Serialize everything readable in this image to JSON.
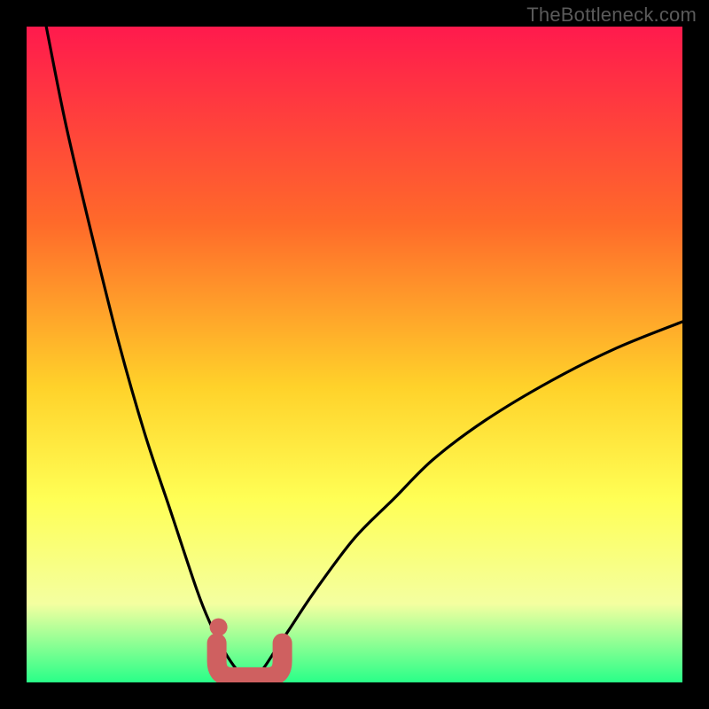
{
  "watermark": "TheBottleneck.com",
  "colors": {
    "bg": "#000000",
    "grad_top": "#ff1a4d",
    "grad_mid1": "#ff6a2a",
    "grad_mid2": "#ffd22a",
    "grad_mid3": "#ffff55",
    "grad_mid4": "#f4ffa0",
    "grad_bottom": "#29ff88",
    "curve": "#000000",
    "marker": "#cf6060"
  },
  "chart_data": {
    "type": "line",
    "title": "",
    "xlabel": "",
    "ylabel": "",
    "xlim": [
      0,
      100
    ],
    "ylim": [
      0,
      100
    ],
    "curve_description": "Two-branch bottleneck curve: y represents bottleneck percentage vs a parameter x (0–100). Minimum (≈0%) occurs near x≈34. Left branch rises steeply toward 100% as x→0; right branch rises more gently toward ~55% as x→100.",
    "series": [
      {
        "name": "bottleneck-curve",
        "x": [
          3,
          6,
          10,
          14,
          18,
          22,
          26,
          28,
          30,
          32,
          34,
          36,
          38,
          40,
          44,
          50,
          56,
          62,
          70,
          80,
          90,
          100
        ],
        "y": [
          100,
          85,
          68,
          52,
          38,
          26,
          14,
          9,
          5,
          2,
          0,
          2,
          5,
          8,
          14,
          22,
          28,
          34,
          40,
          46,
          51,
          55
        ]
      }
    ],
    "highlight_region": {
      "description": "Thick salmon U-shaped marker at the curve minimum",
      "x_range": [
        29,
        39
      ],
      "y_range": [
        0,
        6
      ]
    }
  }
}
